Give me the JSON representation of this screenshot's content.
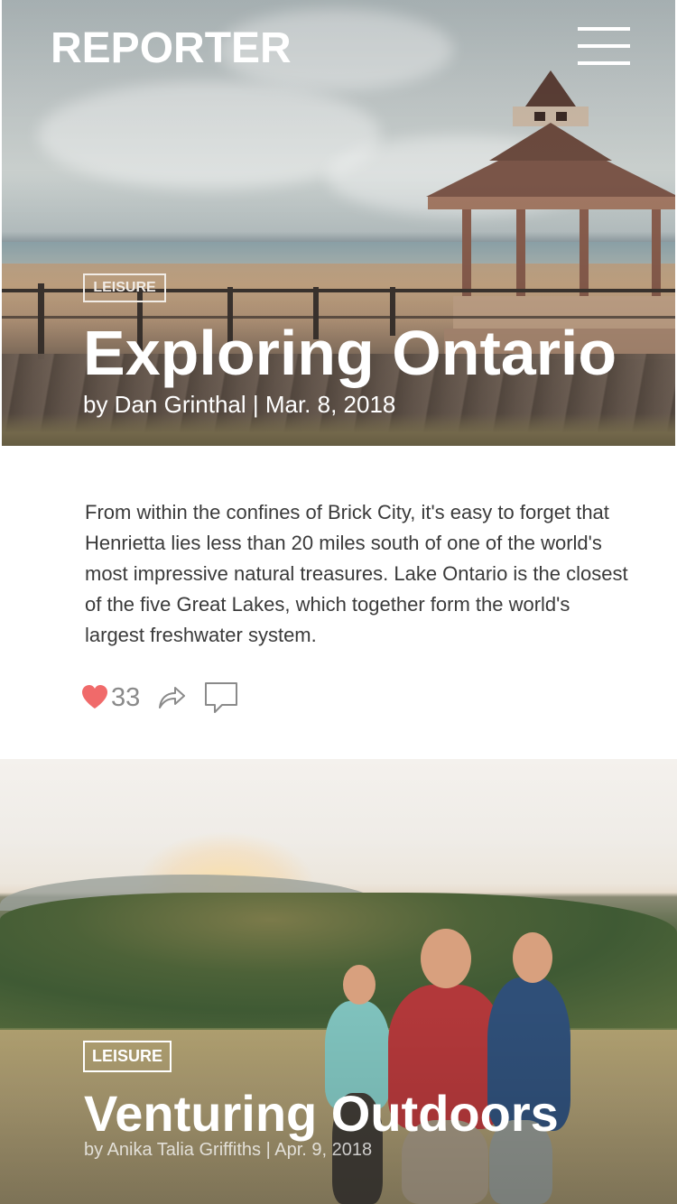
{
  "header": {
    "brand": "REPORTER",
    "menu_icon": "hamburger-menu-icon"
  },
  "articles": [
    {
      "category": "LEISURE",
      "title": "Exploring Ontario",
      "byline": "by Dan Grinthal | Mar. 8, 2018",
      "excerpt": "From within the confines of Brick City, it's easy to forget that Henrietta lies less than 20 miles south of one of the world's most impressive natural treasures. Lake Ontario is the closest of the five Great Lakes, which together form the world's largest freshwater system.",
      "likes": "33",
      "icons": [
        "heart-icon",
        "share-icon",
        "comment-icon"
      ],
      "colors": {
        "heart": "#f06a6a",
        "icon_gray": "#8a8a8a"
      }
    },
    {
      "category": "LEISURE",
      "title": "Venturing Outdoors",
      "byline": "by Anika Talia Griffiths | Apr. 9, 2018"
    }
  ]
}
